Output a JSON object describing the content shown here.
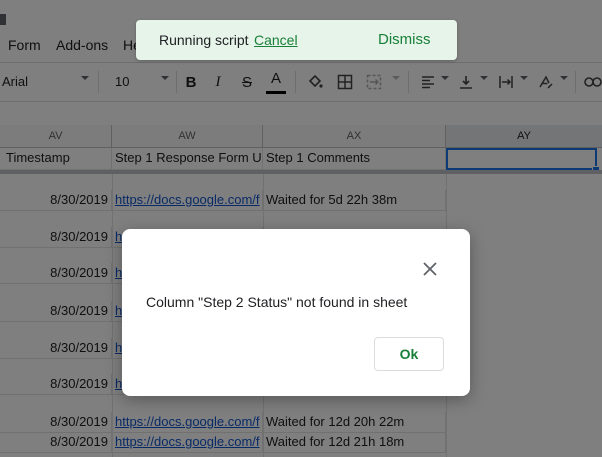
{
  "menubar": {
    "items": [
      "Form",
      "Add-ons",
      "He"
    ]
  },
  "toolbar": {
    "font": "Arial",
    "font_size": "10",
    "bold": "B",
    "italic": "I",
    "strike": "S",
    "text_color_letter": "A",
    "text_color_underline": "#000000"
  },
  "grid": {
    "columns": [
      "AV",
      "AW",
      "AX",
      "AY"
    ],
    "selected_column": "AY",
    "header_row": [
      "Timestamp",
      "Step 1 Response Form U",
      "Step 1 Comments",
      ""
    ],
    "rows": [
      {
        "date": "8/30/2019",
        "link": "https://docs.google.com/f",
        "comment": "Waited for 5d 22h 38m"
      },
      {
        "date": "8/30/2019",
        "link": "h",
        "comment": ""
      },
      {
        "date": "8/30/2019",
        "link": "h",
        "comment": ""
      },
      {
        "date": "8/30/2019",
        "link": "h",
        "comment": ""
      },
      {
        "date": "8/30/2019",
        "link": "h",
        "comment": ""
      },
      {
        "date": "8/30/2019",
        "link": "h",
        "comment": ""
      },
      {
        "date": "8/30/2019",
        "link": "https://docs.google.com/f",
        "comment": "Waited for 12d 20h 22m"
      },
      {
        "date": "8/30/2019",
        "link": "https://docs.google.com/f",
        "comment": "Waited for 12d 21h 18m"
      }
    ]
  },
  "toast": {
    "message": "Running script",
    "cancel": "Cancel",
    "dismiss": "Dismiss",
    "background": "#e6f4ea",
    "accent": "#188038"
  },
  "dialog": {
    "message": "Column \"Step 2 Status\" not found in sheet",
    "ok": "Ok",
    "close_icon": "close-icon"
  }
}
